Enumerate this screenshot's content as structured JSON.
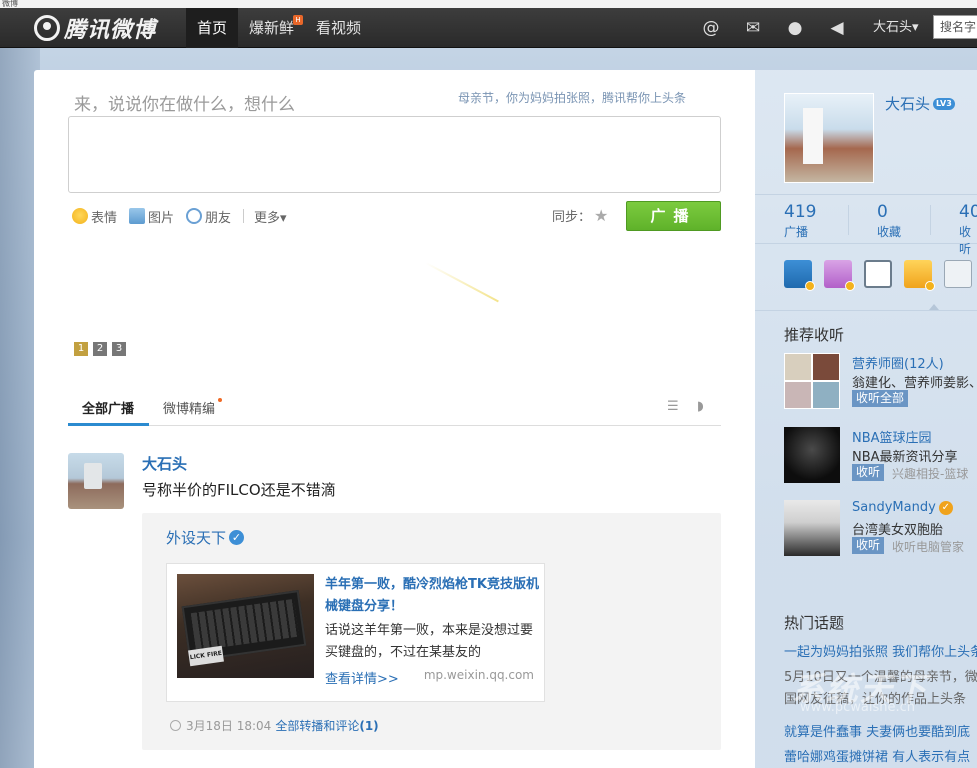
{
  "browser_strip": "微博",
  "nav": {
    "logo": "腾讯微博",
    "tabs": [
      {
        "label": "首页",
        "active": true
      },
      {
        "label": "爆新鲜",
        "badge": "H"
      },
      {
        "label": "看视频"
      }
    ],
    "icons": [
      "at-icon",
      "mail-icon",
      "user-icon",
      "speaker-icon"
    ],
    "user": "大石头",
    "search_placeholder": "搜名字"
  },
  "compose": {
    "title": "来，说说你在做什么，想什么",
    "tip": "母亲节，你为妈妈拍张照，腾讯帮你上头条",
    "tools": {
      "emoji": "表情",
      "image": "图片",
      "friend": "朋友",
      "more": "更多▾"
    },
    "sync": "同步：",
    "post_button": "广播",
    "pages": [
      "1",
      "2",
      "3"
    ]
  },
  "feed_tabs": {
    "all": "全部广播",
    "selected": "微博精编"
  },
  "post": {
    "author": "大石头",
    "text": "号称半价的FILCO还是不错滴",
    "repost": {
      "author": "外设天下",
      "card": {
        "title": "羊年第一败，酷冷烈焰枪TK竞技版机械键盘分享！",
        "desc": "话说这羊年第一败，本来是没想过要买键盘的，不过在某基友的",
        "more": "查看详情>>",
        "source": "mp.weixin.qq.com",
        "img_tag": "LICK FIRE"
      },
      "meta_time": "3月18日 18:04",
      "meta_link": "全部转播和评论",
      "meta_count": "(1)"
    }
  },
  "side": {
    "name": "大石头",
    "level": "LV3",
    "stats": [
      {
        "num": "419",
        "label": "广播"
      },
      {
        "num": "0",
        "label": "收藏"
      },
      {
        "num": "40",
        "label": "收听"
      }
    ],
    "rec_title": "推荐收听",
    "recs": [
      {
        "name": "营养师圈(12人)",
        "desc": "翁建化、营养师姜影、",
        "btn": "收听全部",
        "sub": ""
      },
      {
        "name": "NBA篮球庄园",
        "desc": "NBA最新资讯分享",
        "btn": "收听",
        "sub": "兴趣相投-篮球"
      },
      {
        "name": "SandyMandy",
        "desc": "台湾美女双胞胎",
        "btn": "收听",
        "sub": "收听电脑管家"
      }
    ],
    "hot_title": "热门话题",
    "topics": [
      "一起为妈妈拍张照 我们帮你上头条",
      "5月10日又一个温馨的母亲节，微",
      "国网友征稿，让你的作品上头条",
      "就算是件蠢事 夫妻俩也要酷到底",
      "蕾哈娜鸡蛋摊饼裙 有人表示有点"
    ]
  },
  "watermark": {
    "text": "系统天下",
    "url": "www.pcwaishe.cn"
  }
}
